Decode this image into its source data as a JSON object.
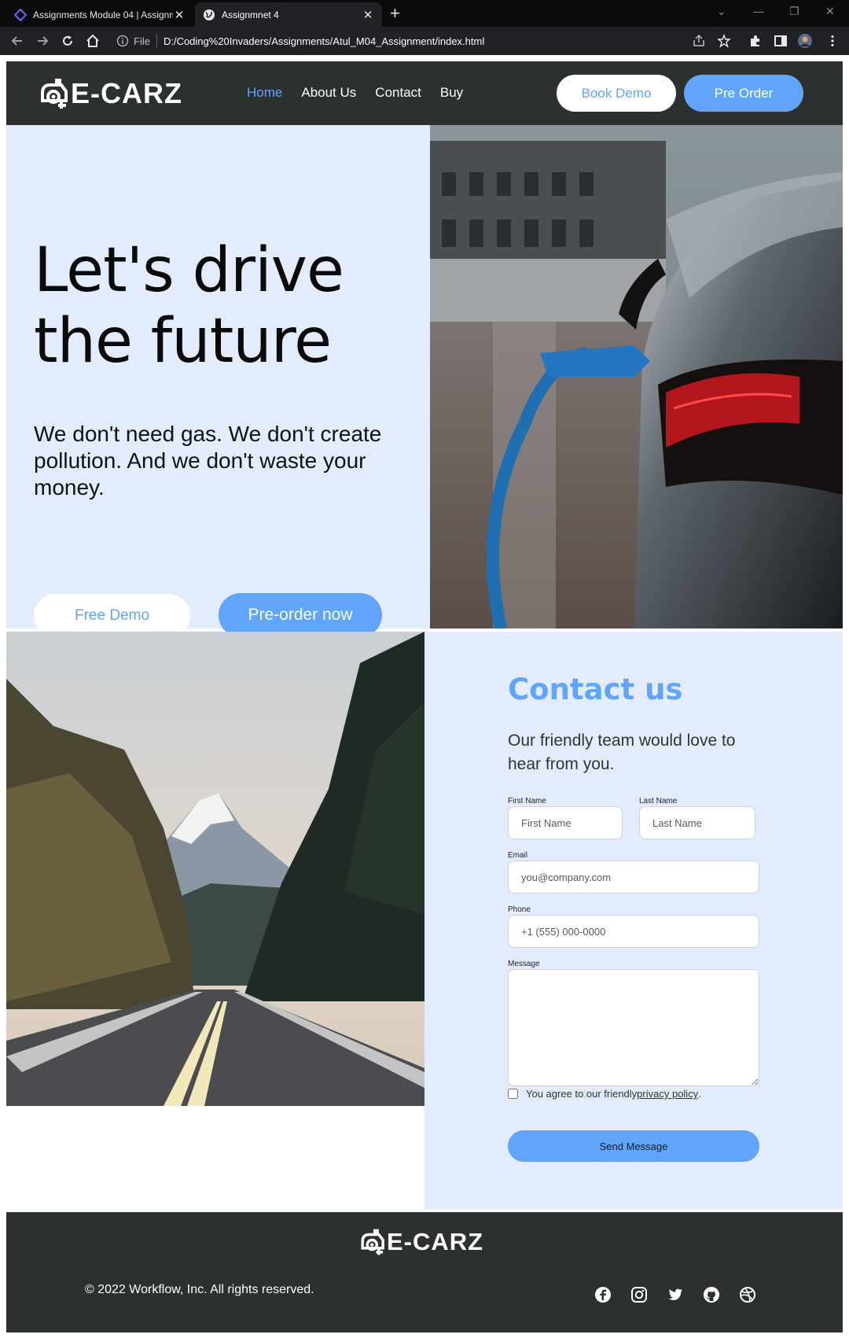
{
  "browser": {
    "tabs": [
      {
        "title": "Assignments Module 04 | Assignme",
        "active": false
      },
      {
        "title": "Assignmnet 4",
        "active": true
      }
    ],
    "address": {
      "scheme_label": "File",
      "url": "D:/Coding%20Invaders/Assignments/Atul_M04_Assignment/index.html"
    }
  },
  "header": {
    "logo_text": "E-CARZ",
    "nav": [
      "Home",
      "About Us",
      "Contact",
      "Buy"
    ],
    "book_demo": "Book Demo",
    "pre_order": "Pre Order"
  },
  "hero": {
    "title": "Let's drive the future",
    "subtitle": "We don't need gas. We don't create pollution. And we don't waste your money.",
    "free_demo": "Free Demo",
    "preorder_now": "Pre-order now"
  },
  "contact": {
    "title": "Contact us",
    "subtitle": "Our friendly team would love to hear from you.",
    "first_name_label": "First Name",
    "first_name_placeholder": "First Name",
    "last_name_label": "Last Name",
    "last_name_placeholder": "Last Name",
    "email_label": "Email",
    "email_placeholder": "you@company.com",
    "phone_label": "Phone",
    "phone_placeholder": "+1 (555) 000-0000",
    "message_label": "Message",
    "agree_prefix": "You agree to our friendly ",
    "agree_link": "privacy policy",
    "agree_suffix": ".",
    "send": "Send Message"
  },
  "footer": {
    "logo_text": "E-CARZ",
    "copyright": "© 2022 Workflow, Inc. All rights reserved.",
    "socials": [
      "facebook-icon",
      "instagram-icon",
      "twitter-icon",
      "github-icon",
      "dribbble-icon"
    ]
  },
  "colors": {
    "accent": "#60a5fa",
    "dark": "#2c302e",
    "light_bg": "#e3ecfc"
  }
}
